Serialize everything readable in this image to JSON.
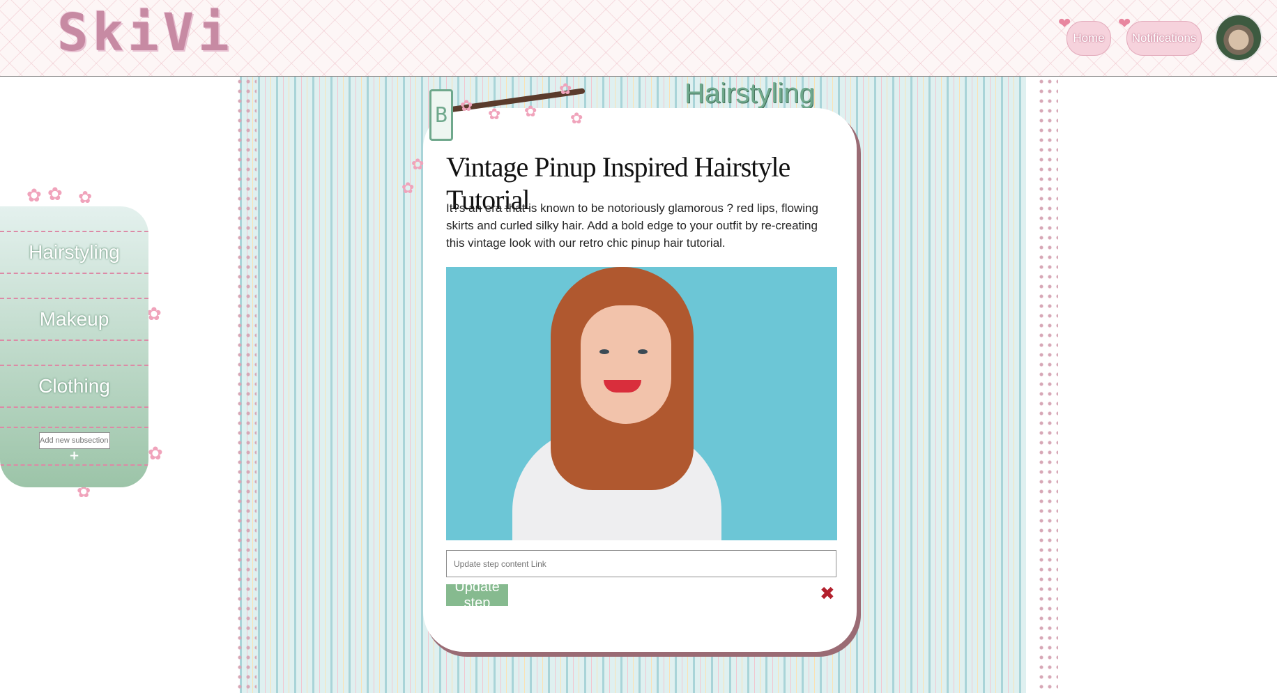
{
  "header": {
    "logo_text": "SkiVi",
    "nav": [
      {
        "label": "Home"
      },
      {
        "label": "Notifications"
      }
    ]
  },
  "sidebar": {
    "items": [
      {
        "label": "Hairstyling"
      },
      {
        "label": "Makeup"
      },
      {
        "label": "Clothing"
      }
    ],
    "add_placeholder": "Add new subsection",
    "add_icon": "plus-icon"
  },
  "main": {
    "section_title": "Hairstyling",
    "post": {
      "title": "Vintage Pinup Inspired Hairstyle Tutorial",
      "body": "It?s an era that is known to be notoriously glamorous ? red lips, flowing skirts and curled silky hair. Add a bold edge to your outfit by re-creating this vintage look with our retro chic pinup hair tutorial.",
      "image_alt": "Smiling woman with red wavy hair"
    },
    "step_input_placeholder": "Update step content Link",
    "update_button": "Update step",
    "delete_icon": "close-icon"
  },
  "colors": {
    "accent_green": "#86ba8f",
    "accent_pink": "#dc8aa6",
    "delete_red": "#b3202d"
  }
}
